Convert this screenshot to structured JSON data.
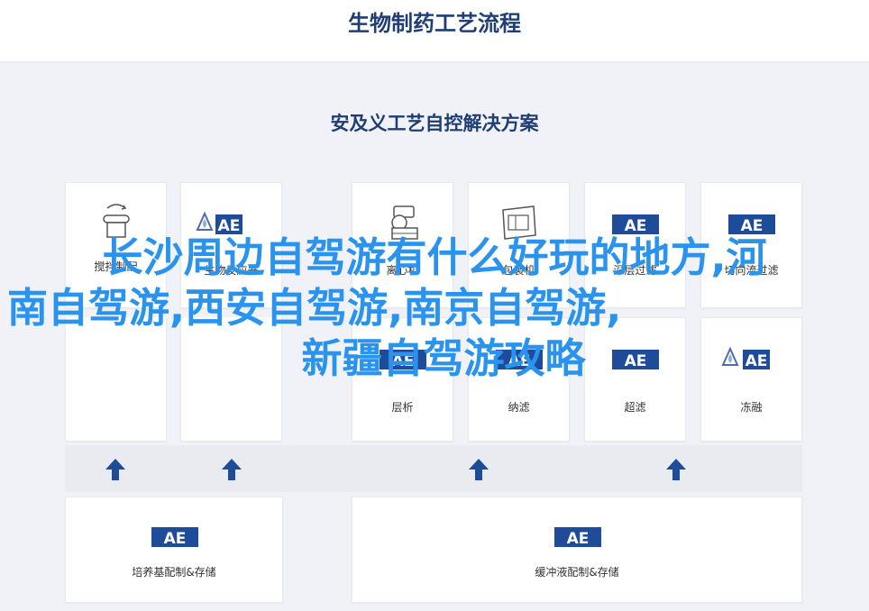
{
  "header": {
    "title": "生物制药工艺流程"
  },
  "panel": {
    "subtitle": "安及义工艺自控解决方案"
  },
  "steps_top": [
    {
      "label": "搅拌制配",
      "icon": "mixer-icon"
    },
    {
      "label": "生物反应器",
      "icon": "ae-logo-icon"
    },
    {
      "label": "离心机",
      "icon": "centrifuge-icon"
    },
    {
      "label": "包装机",
      "icon": "packaging-machine-icon"
    },
    {
      "label": "深层过滤",
      "icon": "ae-logo-icon"
    },
    {
      "label": "切向流过滤",
      "icon": "ae-logo-icon"
    }
  ],
  "steps_mid": [
    {
      "label": "层析",
      "icon": "ae-logo-icon"
    },
    {
      "label": "纳滤",
      "icon": "ae-logo-icon"
    },
    {
      "label": "超滤",
      "icon": "ae-logo-icon"
    },
    {
      "label": "冻融",
      "icon": "ae-logo-icon"
    }
  ],
  "steps_bottom": [
    {
      "label": "培养基配制&存储",
      "icon": "ae-logo-icon"
    },
    {
      "label": "缓冲液配制&存储",
      "icon": "ae-logo-icon"
    }
  ],
  "overlay": {
    "line1": "长沙周边自驾游有什么好玩的地方,河",
    "line2": "南自驾游,西安自驾游,南京自驾游,",
    "line3": "新疆自驾游攻略"
  },
  "colors": {
    "brand": "#1f3e73",
    "logo": "#1f4c98",
    "arrow": "#1f4c98",
    "overlay": "#2a93ee"
  }
}
